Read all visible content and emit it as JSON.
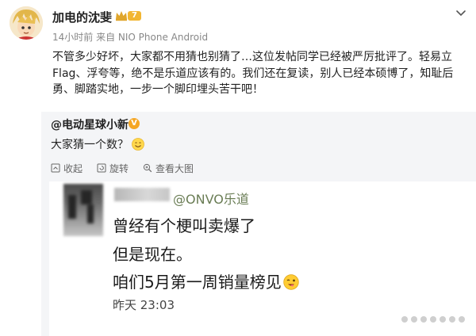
{
  "post": {
    "user_name": "加电的沈斐",
    "badge_level": "7",
    "meta": "14小时前 来自 NIO Phone Android",
    "text_lines": [
      "不管多少好坏，大家都不用猜也别猜了…这位发帖同学已经被严厉批评了。轻易立",
      "Flag、浮夸等，绝不是乐道应该有的。我们还在复读，别人已经本硕博了，知耻后",
      "勇、脚踏实地，一步一个脚印埋头苦干吧！"
    ]
  },
  "retweet": {
    "author": "@电动星球小新",
    "text": "大家猜一个数？",
    "actions": {
      "collapse": "收起",
      "rotate": "旋转",
      "view_large": "查看大图"
    },
    "screenshot": {
      "handle": "@ONVO乐道",
      "lines": [
        "曾经有个梗叫卖爆了",
        "但是现在。",
        "咱们5月第一周销量榜见"
      ],
      "time": "昨天 23:03"
    }
  },
  "colors": {
    "text": "#222222",
    "meta": "#888888",
    "badge": "#f5a623",
    "retweet_bg": "#f4f5f7",
    "handle": "#6a7d55"
  }
}
